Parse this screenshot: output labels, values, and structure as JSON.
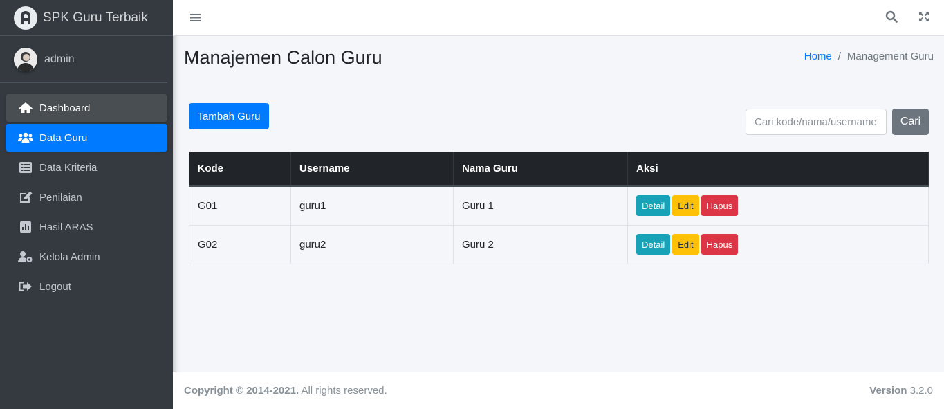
{
  "brand": {
    "name": "SPK Guru Terbaik"
  },
  "user": {
    "name": "admin"
  },
  "sidebar": {
    "items": [
      {
        "label": "Dashboard",
        "icon": "home-icon"
      },
      {
        "label": "Data Guru",
        "icon": "users-icon"
      },
      {
        "label": "Data Kriteria",
        "icon": "list-icon"
      },
      {
        "label": "Penilaian",
        "icon": "edit-icon"
      },
      {
        "label": "Hasil ARAS",
        "icon": "chart-icon"
      },
      {
        "label": "Kelola Admin",
        "icon": "user-cog-icon"
      },
      {
        "label": "Logout",
        "icon": "sign-out-icon"
      }
    ],
    "active": "Data Guru",
    "hovered": "Dashboard"
  },
  "header": {
    "title": "Manajemen Calon Guru",
    "breadcrumb": {
      "home": "Home",
      "current": "Management Guru",
      "separator": "/"
    }
  },
  "toolbar": {
    "add_label": "Tambah Guru",
    "search_placeholder": "Cari kode/nama/username",
    "search_button": "Cari"
  },
  "table": {
    "headers": [
      "Kode",
      "Username",
      "Nama Guru",
      "Aksi"
    ],
    "rows": [
      {
        "kode": "G01",
        "username": "guru1",
        "nama": "Guru 1"
      },
      {
        "kode": "G02",
        "username": "guru2",
        "nama": "Guru 2"
      }
    ],
    "actions": {
      "detail": "Detail",
      "edit": "Edit",
      "hapus": "Hapus"
    }
  },
  "footer": {
    "copyright_strong": "Copyright © 2014-2021.",
    "copyright_rest": " All rights reserved.",
    "version_label": "Version",
    "version_value": " 3.2.0"
  },
  "colors": {
    "primary": "#007bff",
    "sidebar": "#343a40",
    "info": "#17a2b8",
    "warning": "#ffc107",
    "danger": "#dc3545",
    "secondary": "#6c757d"
  }
}
